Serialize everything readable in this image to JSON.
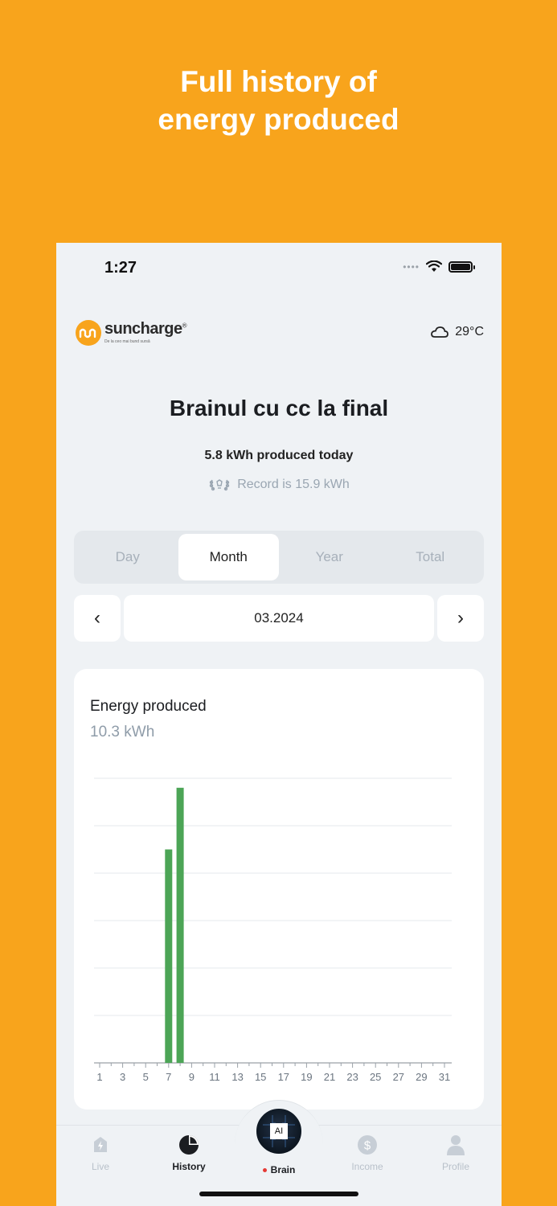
{
  "promo": {
    "line1": "Full history of",
    "line2": "energy produced"
  },
  "status": {
    "time": "1:27"
  },
  "brand": {
    "name": "suncharge",
    "registered": "®",
    "tagline": "De la ceo mai bund sursă"
  },
  "weather": {
    "temp": "29°C",
    "icon": "cloud-icon"
  },
  "site": {
    "name": "Brainul cu cc la final",
    "today": "5.8 kWh produced today",
    "record": "Record is 15.9 kWh"
  },
  "tabs": [
    {
      "label": "Day",
      "active": false
    },
    {
      "label": "Month",
      "active": true
    },
    {
      "label": "Year",
      "active": false
    },
    {
      "label": "Total",
      "active": false
    }
  ],
  "date": {
    "prev": "‹",
    "value": "03.2024",
    "next": "›"
  },
  "card": {
    "title": "Energy produced",
    "value": "10.3 kWh"
  },
  "chart_data": {
    "type": "bar",
    "x_labels": [
      "1",
      "3",
      "5",
      "7",
      "9",
      "11",
      "13",
      "15",
      "17",
      "19",
      "21",
      "23",
      "25",
      "27",
      "29",
      "31"
    ],
    "days": [
      7,
      8
    ],
    "values": [
      4.5,
      5.8
    ],
    "ylim": [
      0,
      6
    ],
    "grid": true,
    "bar_color": "#4CA556"
  },
  "tabbar": {
    "items": [
      {
        "label": "Live",
        "icon": "lightning-icon"
      },
      {
        "label": "History",
        "icon": "pie-chart-icon",
        "active": true
      },
      {
        "label": "Brain",
        "icon": "ai-chip-icon",
        "chip": "AI"
      },
      {
        "label": "Income",
        "icon": "dollar-icon"
      },
      {
        "label": "Profile",
        "icon": "user-icon"
      }
    ]
  },
  "colors": {
    "background": "#F8A41C",
    "accent": "#F8A41C",
    "bar": "#4CA556"
  }
}
